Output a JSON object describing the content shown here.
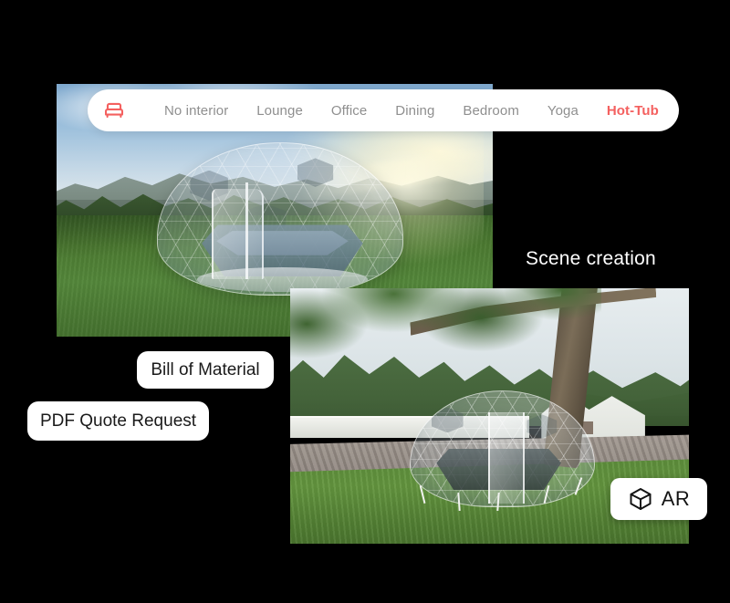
{
  "nav": {
    "icon": "armchair-icon",
    "accent_color": "#f4605f",
    "inactive_color": "#8f8f8f",
    "items": [
      {
        "label": "No interior",
        "active": false
      },
      {
        "label": "Lounge",
        "active": false
      },
      {
        "label": "Office",
        "active": false
      },
      {
        "label": "Dining",
        "active": false
      },
      {
        "label": "Bedroom",
        "active": false
      },
      {
        "label": "Yoga",
        "active": false
      },
      {
        "label": "Hot-Tub",
        "active": true
      }
    ]
  },
  "captions": {
    "scene_creation": "Scene creation"
  },
  "actions": {
    "bill_of_material": "Bill of Material",
    "pdf_quote_request": "PDF Quote Request"
  },
  "ar": {
    "icon": "cube-icon",
    "label": "AR"
  },
  "scenes": {
    "top": {
      "name": "rendered-dome-scene",
      "description": "Geodesic glass dome with hot tub interior on a grass meadow with mountains, trees and sun flare"
    },
    "bottom": {
      "name": "ar-dome-photo",
      "description": "Augmented reality placement of the glass dome on a lawn beside a driveway, large tree and house"
    }
  },
  "background_color": "#000000"
}
